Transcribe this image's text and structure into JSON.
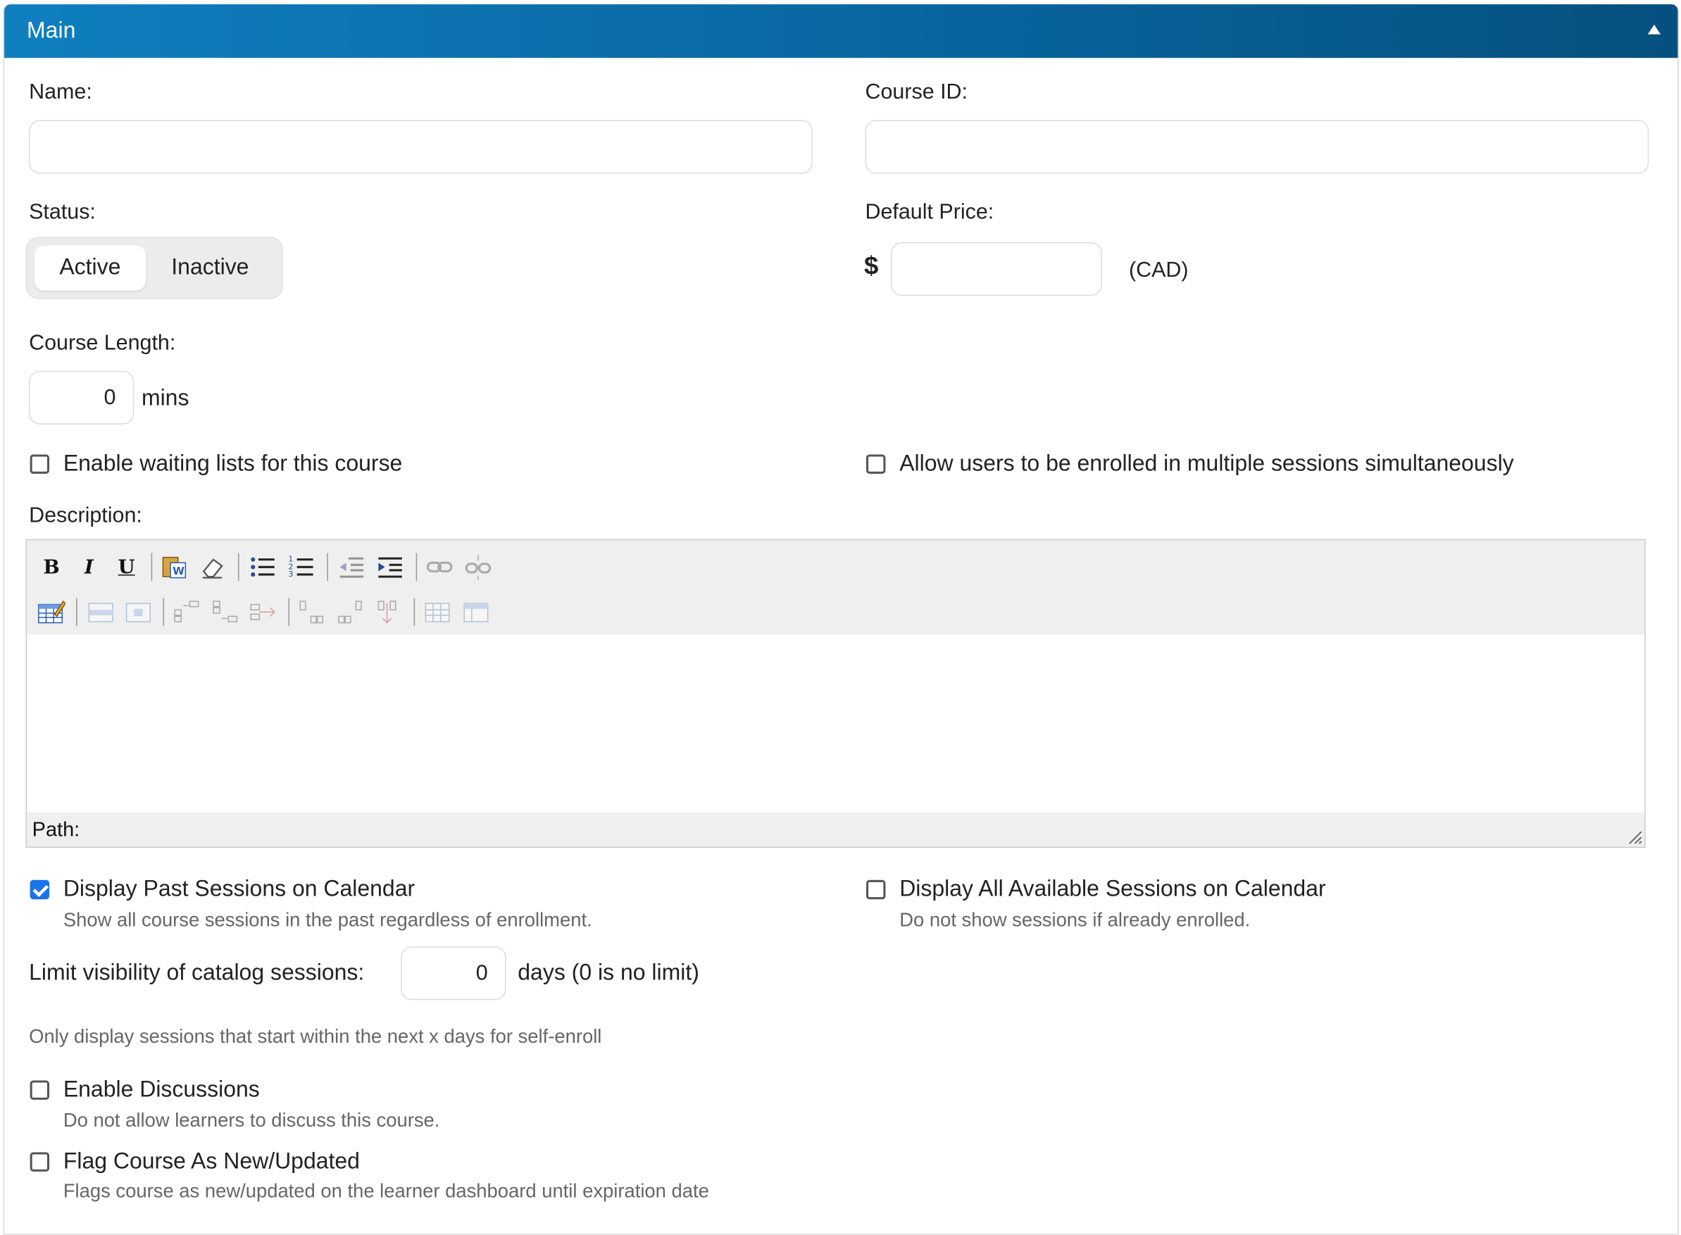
{
  "panel": {
    "title": "Main"
  },
  "fields": {
    "name_label": "Name:",
    "name_value": "",
    "course_id_label": "Course ID:",
    "course_id_value": "",
    "status_label": "Status:",
    "status_options": [
      "Active",
      "Inactive"
    ],
    "status_selected": "Active",
    "default_price_label": "Default Price:",
    "currency_symbol": "$",
    "price_value": "",
    "currency_code": "(CAD)",
    "course_length_label": "Course Length:",
    "course_length_value": "0",
    "course_length_unit": "mins"
  },
  "checkboxes": {
    "waiting_lists": {
      "label": "Enable waiting lists for this course",
      "checked": false
    },
    "multiple_sessions": {
      "label": "Allow users to be enrolled in multiple sessions simultaneously",
      "checked": false
    },
    "past_sessions": {
      "label": "Display Past Sessions on Calendar",
      "help": "Show all course sessions in the past regardless of enrollment.",
      "checked": true
    },
    "all_sessions": {
      "label": "Display All Available Sessions on Calendar",
      "help": "Do not show sessions if already enrolled.",
      "checked": false
    },
    "discussions": {
      "label": "Enable Discussions",
      "help": "Do not allow learners to discuss this course.",
      "checked": false
    },
    "flag_new": {
      "label": "Flag Course As New/Updated",
      "help": "Flags course as new/updated on the learner dashboard until expiration date",
      "checked": false
    }
  },
  "description": {
    "label": "Description:",
    "path_label": "Path:",
    "toolbar_row1": [
      "bold",
      "italic",
      "underline",
      "paste-word",
      "clear-format",
      "bullet-list",
      "numbered-list",
      "outdent",
      "indent",
      "link",
      "unlink"
    ],
    "toolbar_row2": [
      "table",
      "row-props",
      "cell-props",
      "insert-row-before",
      "insert-row-after",
      "delete-row",
      "insert-col-before",
      "insert-col-after",
      "delete-col",
      "split-cells",
      "merge-cells"
    ]
  },
  "visibility": {
    "label": "Limit visibility of catalog sessions:",
    "value": "0",
    "unit": "days (0 is no limit)",
    "help": "Only display sessions that start within the next x days for self-enroll"
  },
  "colors": {
    "header_start": "#0f7fbf",
    "header_end": "#05507f",
    "checkbox_checked": "#1a73e8"
  }
}
